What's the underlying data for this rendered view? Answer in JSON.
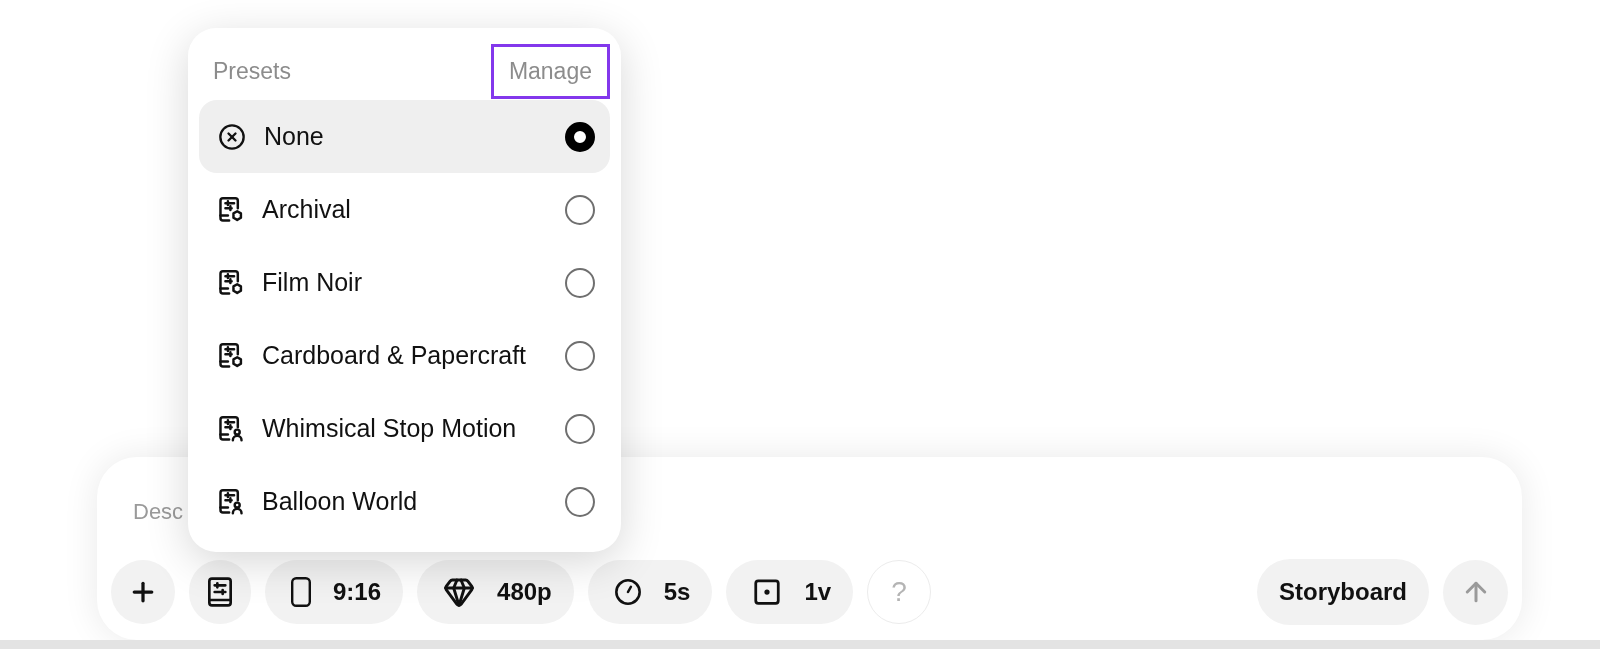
{
  "presets_menu": {
    "title": "Presets",
    "manage_link": {
      "label": "Manage",
      "highlighted": true
    },
    "items": [
      {
        "label": "None",
        "kind": "none",
        "selected": true
      },
      {
        "label": "Archival",
        "kind": "style",
        "selected": false
      },
      {
        "label": "Film Noir",
        "kind": "style",
        "selected": false
      },
      {
        "label": "Cardboard & Papercraft",
        "kind": "style",
        "selected": false
      },
      {
        "label": "Whimsical Stop Motion",
        "kind": "character",
        "selected": false
      },
      {
        "label": "Balloon World",
        "kind": "character",
        "selected": false
      }
    ]
  },
  "composer": {
    "input": {
      "placeholder": "Desc"
    },
    "settings_chips": [
      {
        "kind": "aspect",
        "label": "9:16"
      },
      {
        "kind": "quality",
        "label": "480p"
      },
      {
        "kind": "duration",
        "label": "5s"
      },
      {
        "kind": "count",
        "label": "1v"
      }
    ],
    "help_button": {
      "label": "?"
    },
    "mode_button": {
      "label": "Storyboard"
    },
    "send_button": {
      "disabled": true
    }
  }
}
